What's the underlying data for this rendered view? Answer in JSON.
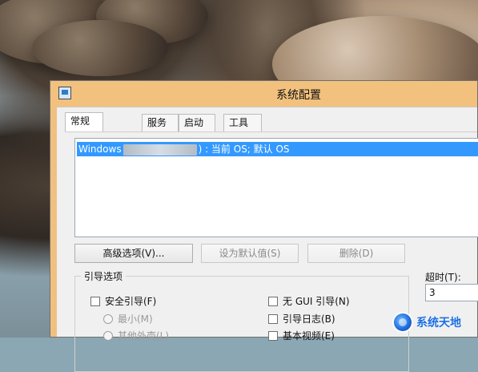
{
  "window": {
    "title": "系统配置"
  },
  "tabs": [
    {
      "label": "常规"
    },
    {
      "label": "服务"
    },
    {
      "label": "启动"
    },
    {
      "label": "工具"
    }
  ],
  "boot_list": {
    "selected_text_prefix": "Windows",
    "selected_text_suffix": ") : 当前 OS; 默认 OS"
  },
  "buttons": {
    "advanced": "高级选项(V)...",
    "set_default": "设为默认值(S)",
    "delete": "删除(D)"
  },
  "boot_options": {
    "group_title": "引导选项",
    "safe_boot": "安全引导(F)",
    "minimal": "最小(M)",
    "other_shell": "其他外壳(L)",
    "no_gui": "无 GUI 引导(N)",
    "boot_log": "引导日志(B)",
    "base_video": "基本视频(E)"
  },
  "timeout": {
    "label": "超时(T):",
    "value": "3"
  },
  "watermark": {
    "text": "系统天地"
  },
  "icons": {
    "window": "msconfig-window-icon",
    "watermark": "watermark-logo-icon"
  },
  "colors": {
    "titlebar": "#f3c17e",
    "selection": "#3399ff",
    "watermark": "#1c6fe0"
  }
}
